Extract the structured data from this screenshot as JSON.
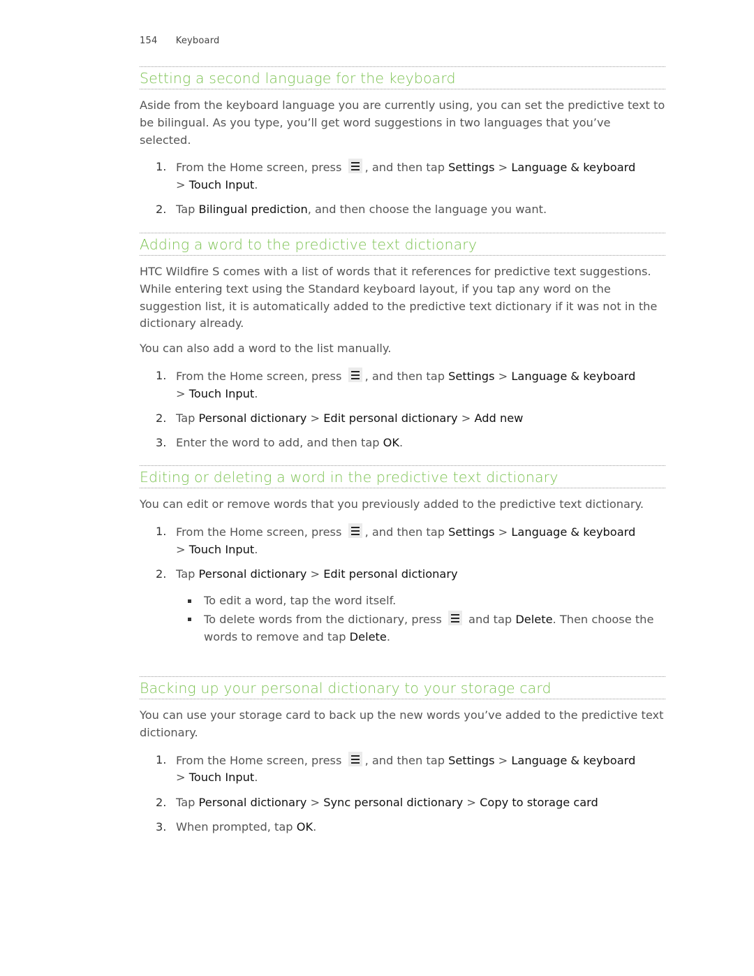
{
  "header": {
    "page_number": "154",
    "chapter": "Keyboard"
  },
  "sections": [
    {
      "title": "Setting a second language for the keyboard",
      "paragraphs": [
        "Aside from the keyboard language you are currently using, you can set the predictive text to be bilingual. As you type, you’ll get word suggestions in two languages that you’ve selected."
      ],
      "steps": [
        {
          "num": "1.",
          "a": "From the Home screen, press ",
          "b": ", and then tap ",
          "c": "Settings",
          "d": " > ",
          "e": "Language & keyboard",
          "f": " > ",
          "g": "Touch Input",
          "h": "."
        },
        {
          "num": "2.",
          "a": "Tap ",
          "b": "Bilingual prediction",
          "c": ", and then choose the language you want."
        }
      ]
    },
    {
      "title": "Adding a word to the predictive text dictionary",
      "paragraphs": [
        "HTC Wildfire S comes with a list of words that it references for predictive text suggestions. While entering text using the Standard keyboard layout, if you tap any word on the suggestion list, it is automatically added to the predictive text dictionary if it was not in the dictionary already.",
        "You can also add a word to the list manually."
      ],
      "steps": [
        {
          "num": "1.",
          "a": "From the Home screen, press ",
          "b": ", and then tap ",
          "c": "Settings",
          "d": " > ",
          "e": "Language & keyboard",
          "f": " > ",
          "g": "Touch Input",
          "h": "."
        },
        {
          "num": "2.",
          "a": "Tap ",
          "b": "Personal dictionary",
          "c": " > ",
          "d": "Edit personal dictionary",
          "e": " > ",
          "f": "Add new"
        },
        {
          "num": "3.",
          "a": "Enter the word to add, and then tap ",
          "b": "OK",
          "c": "."
        }
      ]
    },
    {
      "title": "Editing or deleting a word in the predictive text dictionary",
      "paragraphs": [
        "You can edit or remove words that you previously added to the predictive text dictionary."
      ],
      "steps": [
        {
          "num": "1.",
          "a": "From the Home screen, press ",
          "b": ", and then tap ",
          "c": "Settings",
          "d": " > ",
          "e": "Language & keyboard",
          "f": " > ",
          "g": "Touch Input",
          "h": "."
        },
        {
          "num": "2.",
          "a": "Tap ",
          "b": "Personal dictionary",
          "c": " > ",
          "d": "Edit personal dictionary"
        }
      ],
      "bullets": [
        {
          "a": "To edit a word, tap the word itself."
        },
        {
          "a": "To delete words from the dictionary, press ",
          "b": " and tap ",
          "c": "Delete",
          "d": ". Then choose the words to remove and tap ",
          "e": "Delete",
          "f": "."
        }
      ]
    },
    {
      "title": "Backing up your personal dictionary to your storage card",
      "paragraphs": [
        "You can use your storage card to back up the new words you’ve added to the predictive text dictionary."
      ],
      "steps": [
        {
          "num": "1.",
          "a": "From the Home screen, press ",
          "b": ", and then tap ",
          "c": "Settings",
          "d": " > ",
          "e": "Language & keyboard",
          "f": " > ",
          "g": "Touch Input",
          "h": "."
        },
        {
          "num": "2.",
          "a": "Tap ",
          "b": "Personal dictionary",
          "c": " > ",
          "d": "Sync personal dictionary",
          "e": " > ",
          "f": "Copy to storage card"
        },
        {
          "num": "3.",
          "a": "When prompted, tap ",
          "b": "OK",
          "c": "."
        }
      ]
    }
  ],
  "icons": {
    "menu": "menu-key-icon"
  },
  "colors": {
    "heading": "#7cc252",
    "body": "#555555",
    "ui_term": "#111111"
  }
}
